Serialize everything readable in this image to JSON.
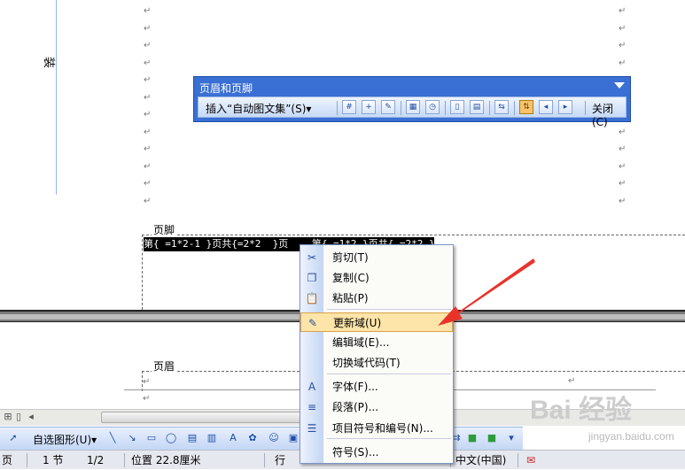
{
  "document": {
    "vertical_label": "装",
    "paragraph_mark": "↵",
    "footer_label": "页脚",
    "field_code_text": "第{ =1*2-1 }页共{=2*2  }页    第{ =1*2 }页共{ =2*2 }页↵",
    "header_label": "页眉"
  },
  "hf_toolbar": {
    "title": "页眉和页脚",
    "insert_autotext": "插入“自动图文集”(S)▾",
    "close": "关闭(C)",
    "icons": [
      "page-number-icon",
      "page-count-icon",
      "format-page-number-icon",
      "date-icon",
      "time-icon",
      "page-setup-icon",
      "show-hide-text-icon",
      "same-as-previous-icon",
      "switch-header-footer-icon",
      "show-previous-icon",
      "show-next-icon"
    ]
  },
  "context_menu": {
    "items": [
      {
        "label": "剪切(T)",
        "icon": "scissors-icon",
        "glyph": "✂"
      },
      {
        "label": "复制(C)",
        "icon": "copy-icon",
        "glyph": "❐"
      },
      {
        "label": "粘贴(P)",
        "icon": "paste-icon",
        "glyph": "📋"
      },
      {
        "label": "更新域(U)",
        "icon": "update-field-icon",
        "glyph": "✎",
        "highlighted": true
      },
      {
        "label": "编辑域(E)...",
        "icon": "",
        "glyph": ""
      },
      {
        "label": "切换域代码(T)",
        "icon": "",
        "glyph": ""
      },
      {
        "label": "字体(F)...",
        "icon": "font-icon",
        "glyph": "A"
      },
      {
        "label": "段落(P)...",
        "icon": "paragraph-icon",
        "glyph": "≡"
      },
      {
        "label": "项目符号和编号(N)...",
        "icon": "bullets-icon",
        "glyph": "☰"
      },
      {
        "label": "符号(S)...",
        "icon": "",
        "glyph": ""
      }
    ]
  },
  "drawing_toolbar": {
    "autoshapes": "自选图形(U)▾"
  },
  "status_bar": {
    "page": "页",
    "section": "1 节",
    "page_of": "1/2",
    "position": "位置 22.8厘米",
    "line": "行",
    "language": "中文(中国)"
  },
  "watermark": {
    "brand": "Bai 经验",
    "url": "jingyan.baidu.com"
  },
  "colors": {
    "toolbar_blue": "#3a6fd3",
    "highlight": "#fde4a8",
    "arrow_red": "#e8332b"
  }
}
